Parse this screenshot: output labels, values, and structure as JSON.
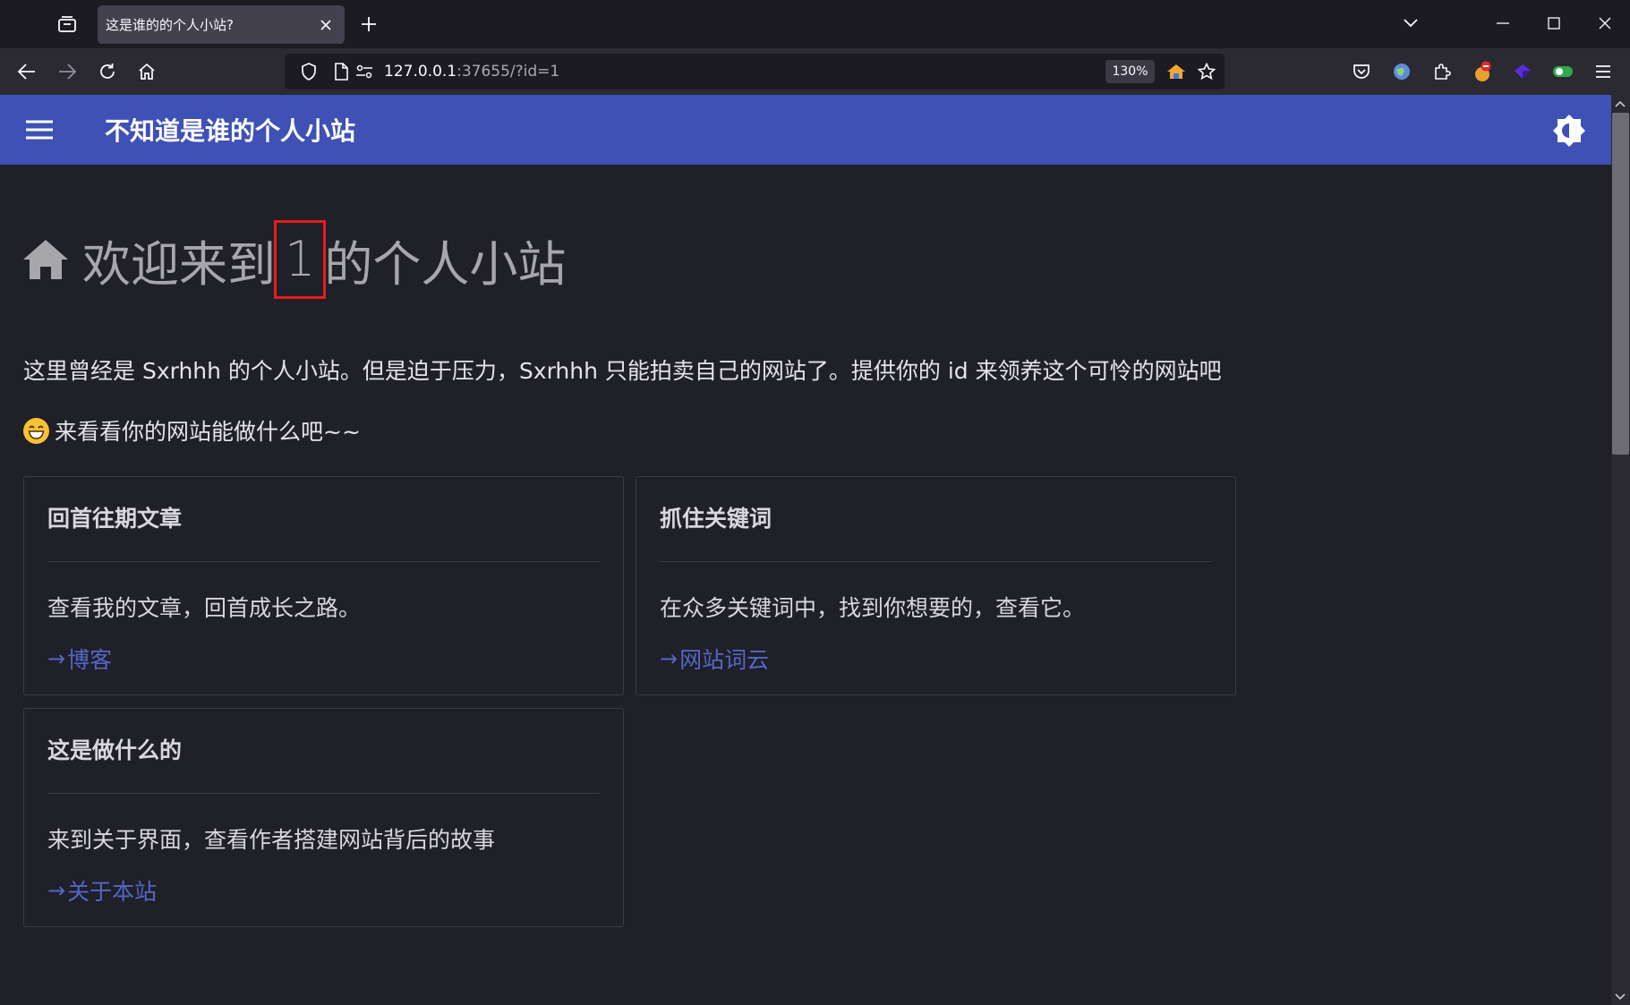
{
  "browser": {
    "tab_title": "这是谁的的个人小站?",
    "url_host": "127.0.0.1",
    "url_rest": ":37655/?id=1",
    "zoom": "130%"
  },
  "site": {
    "title": "不知道是谁的个人小站"
  },
  "hero": {
    "prefix": "欢迎来到",
    "id_value": "1",
    "suffix": "的个人小站"
  },
  "intro_text": "这里曾经是 Sxrhhh 的个人小站。但是迫于压力，Sxrhhh 只能拍卖自己的网站了。提供你的 id 来领养这个可怜的网站吧",
  "cta_text": "来看看你的网站能做什么吧~~",
  "cards": [
    {
      "title": "回首往期文章",
      "text": "查看我的文章，回首成长之路。",
      "link": "博客"
    },
    {
      "title": "抓住关键词",
      "text": "在众多关键词中，找到你想要的，查看它。",
      "link": "网站词云"
    },
    {
      "title": "这是做什么的",
      "text": "来到关于界面，查看作者搭建网站背后的故事",
      "link": "关于本站"
    }
  ],
  "colors": {
    "appbar": "#3f51b5",
    "page_bg": "#1f2028",
    "link": "#5566c6",
    "highlight_box": "#e81c1c"
  }
}
